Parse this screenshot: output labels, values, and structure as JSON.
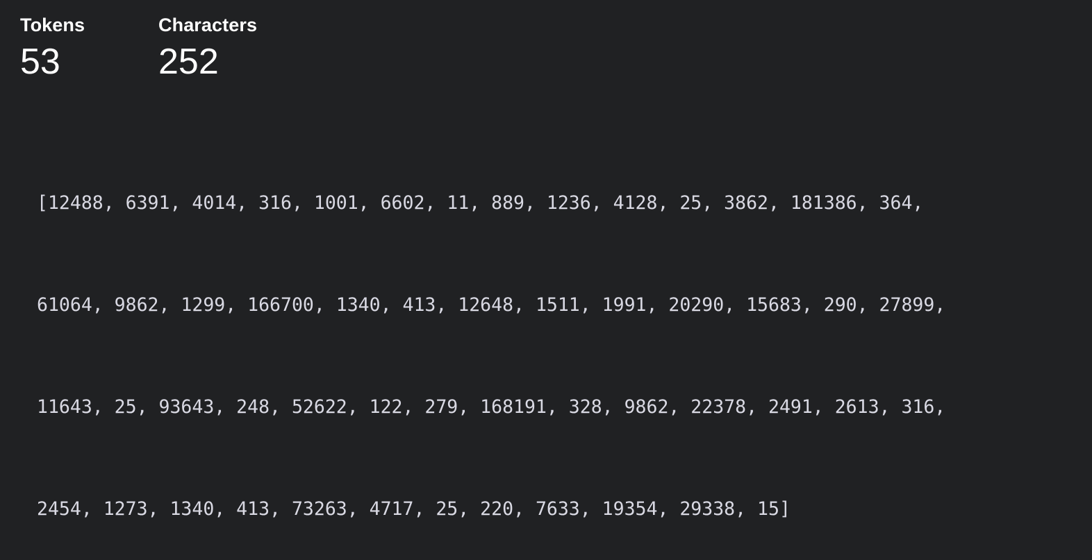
{
  "stats": {
    "tokens_label": "Tokens",
    "tokens_value": "53",
    "characters_label": "Characters",
    "characters_value": "252"
  },
  "token_output": {
    "line1": "[12488, 6391, 4014, 316, 1001, 6602, 11, 889, 1236, 4128, 25, 3862, 181386, 364,",
    "line2": "61064, 9862, 1299, 166700, 1340, 413, 12648, 1511, 1991, 20290, 15683, 290, 27899,",
    "line3": "11643, 25, 93643, 248, 52622, 122, 279, 168191, 328, 9862, 22378, 2491, 2613, 316,",
    "line4": "2454, 1273, 1340, 413, 73263, 4717, 25, 220, 7633, 19354, 29338, 15]"
  }
}
